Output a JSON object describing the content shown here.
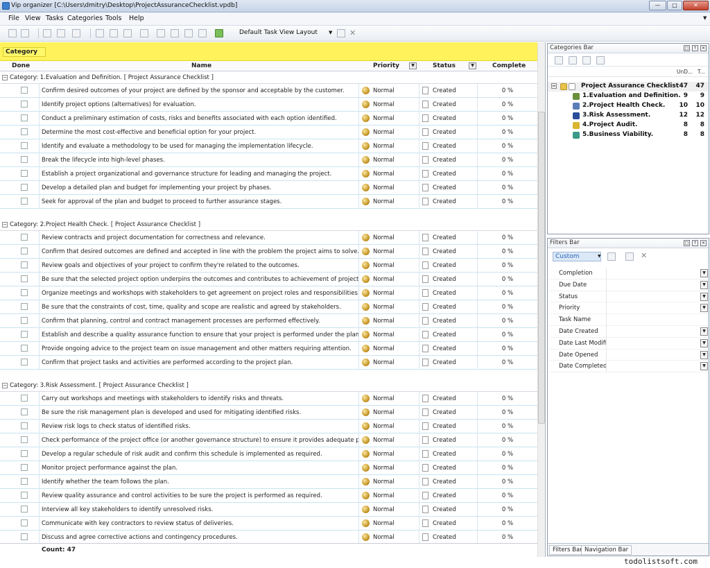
{
  "window": {
    "title": "Vip organizer [C:\\Users\\dmitry\\Desktop\\ProjectAssuranceChecklist.vpdb]"
  },
  "menu": [
    "File",
    "View",
    "Tasks",
    "Categories",
    "Tools",
    "Help"
  ],
  "toolbar": {
    "layout": "Default Task View Layout"
  },
  "grid": {
    "group_label": "Category",
    "columns": {
      "done": "Done",
      "name": "Name",
      "priority": "Priority",
      "status": "Status",
      "complete": "Complete"
    },
    "count": "Count: 47",
    "groups": [
      {
        "header": "Category: 1.Evaluation and Definition.    [ Project Assurance Checklist ]",
        "tasks": [
          "Confirm desired outcomes of your project are defined by the sponsor and acceptable by the customer.",
          "Identify project options (alternatives) for evaluation.",
          "Conduct a preliminary estimation of costs, risks and benefits associated with each option identified.",
          "Determine the most cost-effective and beneficial option for your project.",
          "Identify and evaluate a methodology to be used for managing the implementation lifecycle.",
          "Break the lifecycle into high-level phases.",
          "Establish a project organizational and governance structure for leading and managing the project.",
          "Develop a detailed plan and budget for implementing your project by phases.",
          "Seek for approval of the plan and budget to proceed to further assurance stages."
        ]
      },
      {
        "header": "Category: 2.Project Health Check.    [ Project Assurance Checklist ]",
        "tasks": [
          "Review contracts and project documentation for correctness and relevance.",
          "Confirm that desired outcomes are defined and accepted in line with the problem the project aims to solve.",
          "Review goals and objectives of your project to confirm they're related to the outcomes.",
          "Be sure that the selected project option underpins the outcomes and contributes to achievement of project goals.",
          "Organize meetings and workshops with stakeholders to get agreement on project roles and responsibilities.",
          "Be sure that the constraints of cost, time, quality and scope are realistic and agreed by stakeholders.",
          "Confirm that planning, control and contract management processes are performed effectively.",
          "Establish and describe a quality assurance function to ensure that your project is performed under the plan and that any",
          "Provide ongoing advice to the project team on issue management and other matters requiring attention.",
          "Confirm that project tasks and activities are performed according to the project plan."
        ]
      },
      {
        "header": "Category: 3.Risk Assessment.    [ Project Assurance Checklist ]",
        "tasks": [
          "Carry out workshops and meetings with stakeholders to identify risks and threats.",
          "Be sure the risk management plan is developed and used for mitigating identified risks.",
          "Review risk logs to check status of identified risks.",
          "Check performance of the project office (or another governance structure) to ensure it provides adequate planning and",
          "Develop a regular schedule of risk audit and confirm this schedule is implemented as required.",
          "Monitor project performance against the plan.",
          "Identify whether the team follows the plan.",
          "Review quality assurance and control activities to be sure the project is performed as required.",
          "Interview all key stakeholders to identify unresolved risks.",
          "Communicate with key contractors to review status of deliveries.",
          "Discuss and agree corrective actions and contingency procedures."
        ]
      }
    ],
    "row_priority": "Normal",
    "row_status": "Created",
    "row_complete": "0 %"
  },
  "categories_bar": {
    "title": "Categories Bar",
    "col1": "UnD...",
    "col2": "T...",
    "items": [
      {
        "label": "Project Assurance Checklist",
        "undone": "47",
        "total": "47",
        "color": "#e8c34a"
      },
      {
        "label": "1.Evaluation and Definition.",
        "undone": "9",
        "total": "9",
        "color": "#6b8f3a"
      },
      {
        "label": "2.Project Health Check.",
        "undone": "10",
        "total": "10",
        "color": "#5b7fb8"
      },
      {
        "label": "3.Risk Assessment.",
        "undone": "12",
        "total": "12",
        "color": "#2c4f9a"
      },
      {
        "label": "4.Project Audit.",
        "undone": "8",
        "total": "8",
        "color": "#d9b530"
      },
      {
        "label": "5.Business Viability.",
        "undone": "8",
        "total": "8",
        "color": "#3a9a8a"
      }
    ]
  },
  "filters_bar": {
    "title": "Filters Bar",
    "preset": "Custom",
    "fields": [
      {
        "label": "Completion",
        "dd": true
      },
      {
        "label": "Due Date",
        "dd": true
      },
      {
        "label": "Status",
        "dd": true
      },
      {
        "label": "Priority",
        "dd": true
      },
      {
        "label": "Task Name",
        "dd": false
      },
      {
        "label": "Date Created",
        "dd": true
      },
      {
        "label": "Date Last Modified",
        "dd": true
      },
      {
        "label": "Date Opened",
        "dd": true
      },
      {
        "label": "Date Completed",
        "dd": true
      }
    ],
    "tabs": [
      "Filters Bar",
      "Navigation Bar"
    ]
  },
  "watermark": "todolistsoft.com"
}
